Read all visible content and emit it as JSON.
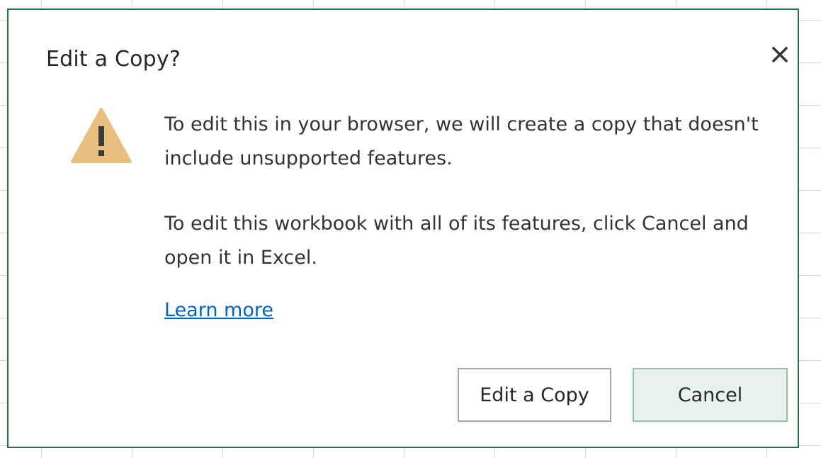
{
  "dialog": {
    "title": "Edit a Copy?",
    "close_icon": "close-icon",
    "warning_icon": "warning-icon",
    "message_line_1": "To edit this in your browser, we will create a copy that doesn't include unsupported features.",
    "message_line_2": "To edit this workbook with all of its features, click Cancel and open it in Excel.",
    "learn_more_label": "Learn more",
    "buttons": {
      "edit_copy_label": "Edit a Copy",
      "cancel_label": "Cancel"
    }
  },
  "colors": {
    "border": "#217346",
    "warning": "#e8bf7f",
    "link": "#0563c1",
    "cancel_bg": "#e8f2ec"
  }
}
